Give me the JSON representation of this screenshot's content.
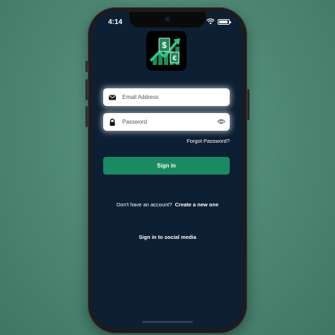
{
  "status_bar": {
    "time": "4:14"
  },
  "logo": {
    "name": "finance-app-logo",
    "dollar": "$",
    "euro": "€"
  },
  "login": {
    "email_placeholder": "Email Address",
    "password_placeholder": "Password",
    "forgot_password": "Forgot Password?",
    "sign_in": "Sign in",
    "no_account_text": "Don't have an account?",
    "create_account": "Create a new one",
    "social_sign_in": "Sign in to social media"
  },
  "colors": {
    "background": "#4c8672",
    "screen": "#0d1f33",
    "accent": "#1a8a63",
    "field": "#ffffff"
  }
}
